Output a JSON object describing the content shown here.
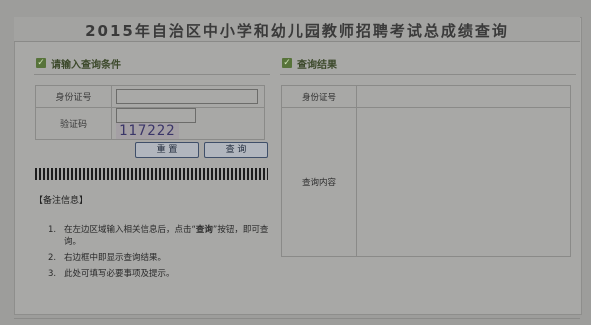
{
  "page": {
    "title": "2015年自治区中小学和幼儿园教师招聘考试总成绩查询"
  },
  "query_section": {
    "heading": "请输入查询条件",
    "fields": [
      {
        "label": "身份证号",
        "value": ""
      },
      {
        "label": "验证码",
        "value": ""
      }
    ],
    "captcha_text": "117222",
    "buttons": {
      "reset": "重 置",
      "query": "查 询"
    }
  },
  "notice": {
    "title": "【备注信息】",
    "items": [
      {
        "num": "1.",
        "text_before": "在左边区域输入相关信息后，点击“",
        "emph": "查询",
        "text_after": "”按钮，即可查询。"
      },
      {
        "num": "2.",
        "text": "右边框中即显示查询结果。"
      },
      {
        "num": "3.",
        "text": "此处可填写必要事项及提示。"
      }
    ]
  },
  "result_section": {
    "heading": "查询结果",
    "rows": [
      {
        "label": "身份证号",
        "value": ""
      },
      {
        "label": "查询内容",
        "value": ""
      }
    ]
  },
  "colors": {
    "section_icon": "#57733a",
    "button_border": "#3f4f69",
    "captcha_text": "#3a3568"
  }
}
